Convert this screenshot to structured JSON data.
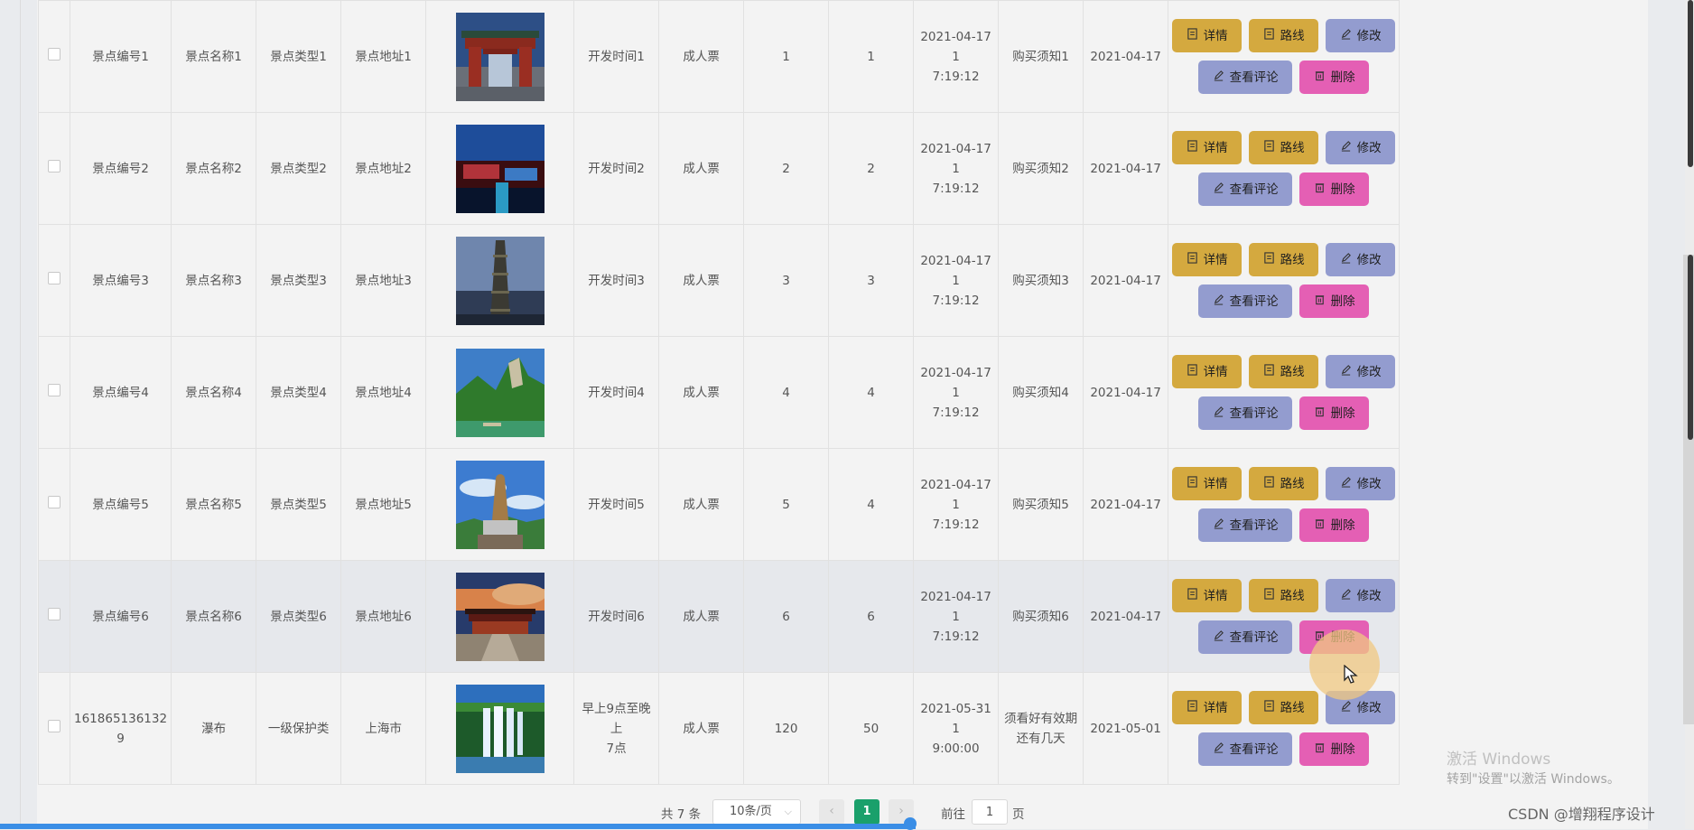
{
  "rows": [
    {
      "code": "景点编号1",
      "name": "景点名称1",
      "type": "景点类型1",
      "addr": "景点地址1",
      "open": "开发时间1",
      "ticket": "成人票",
      "n1": "1",
      "n2": "1",
      "datetime": [
        "2021-04-17 1",
        "7:19:12"
      ],
      "notice": "购买须知1",
      "date": "2021-04-17",
      "image": "archway"
    },
    {
      "code": "景点编号2",
      "name": "景点名称2",
      "type": "景点类型2",
      "addr": "景点地址2",
      "open": "开发时间2",
      "ticket": "成人票",
      "n1": "2",
      "n2": "2",
      "datetime": [
        "2021-04-17 1",
        "7:19:12"
      ],
      "notice": "购买须知2",
      "date": "2021-04-17",
      "image": "night-town"
    },
    {
      "code": "景点编号3",
      "name": "景点名称3",
      "type": "景点类型3",
      "addr": "景点地址3",
      "open": "开发时间3",
      "ticket": "成人票",
      "n1": "3",
      "n2": "3",
      "datetime": [
        "2021-04-17 1",
        "7:19:12"
      ],
      "notice": "购买须知3",
      "date": "2021-04-17",
      "image": "pagoda"
    },
    {
      "code": "景点编号4",
      "name": "景点名称4",
      "type": "景点类型4",
      "addr": "景点地址4",
      "open": "开发时间4",
      "ticket": "成人票",
      "n1": "4",
      "n2": "4",
      "datetime": [
        "2021-04-17 1",
        "7:19:12"
      ],
      "notice": "购买须知4",
      "date": "2021-04-17",
      "image": "green-mountain"
    },
    {
      "code": "景点编号5",
      "name": "景点名称5",
      "type": "景点类型5",
      "addr": "景点地址5",
      "open": "开发时间5",
      "ticket": "成人票",
      "n1": "5",
      "n2": "4",
      "datetime": [
        "2021-04-17 1",
        "7:19:12"
      ],
      "notice": "购买须知5",
      "date": "2021-04-17",
      "image": "statue"
    },
    {
      "code": "景点编号6",
      "name": "景点名称6",
      "type": "景点类型6",
      "addr": "景点地址6",
      "open": "开发时间6",
      "ticket": "成人票",
      "n1": "6",
      "n2": "6",
      "datetime": [
        "2021-04-17 1",
        "7:19:12"
      ],
      "notice": "购买须知6",
      "date": "2021-04-17",
      "image": "temple-sunset"
    },
    {
      "code": "161865136132\n9",
      "name": "瀑布",
      "type": "一级保护类",
      "addr": "上海市",
      "open": "早上9点至晚上\n7点",
      "ticket": "成人票",
      "n1": "120",
      "n2": "50",
      "datetime": [
        "2021-05-31 1",
        "9:00:00"
      ],
      "notice": "须看好有效期\n还有几天",
      "date": "2021-05-01",
      "image": "waterfall"
    }
  ],
  "buttons": {
    "detail": "详情",
    "route": "路线",
    "edit": "修改",
    "review": "查看评论",
    "delete": "删除"
  },
  "hovered_row_index": 5,
  "pagination": {
    "total": "共 7 条",
    "page_size": "10条/页",
    "current_page": "1",
    "goto_label": "前往",
    "goto_value": "1",
    "page_suffix": "页"
  },
  "watermark": {
    "activate_line1": "激活 Windows",
    "activate_line2": "转到\"设置\"以激活 Windows。",
    "csdn": "CSDN @增翔程序设计"
  },
  "colors": {
    "gold_button": "#d4a93f",
    "blue_button": "#939ccf",
    "delete_button": "#e45fb4",
    "pager_active": "#1aa06b"
  }
}
